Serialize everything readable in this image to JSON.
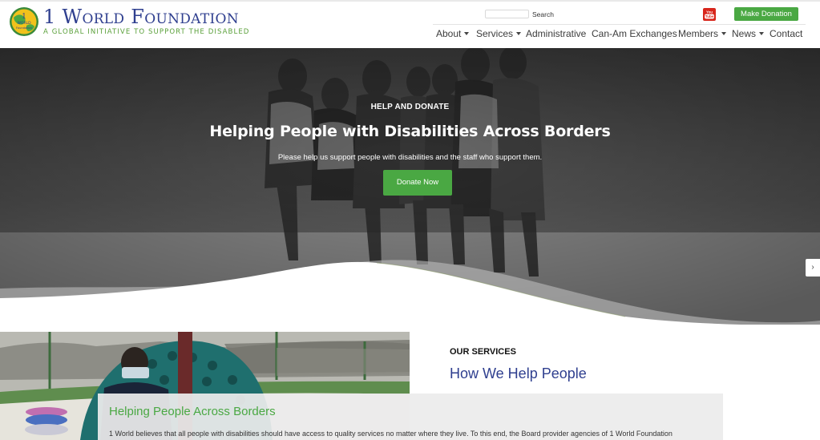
{
  "header": {
    "logo_title": "1 World Foundation",
    "logo_tagline": "A Global Initiative to Support the Disabled",
    "logo_globe_text": "WORLD",
    "logo_globe_sub": "Foundation",
    "search_label": "Search",
    "search_value": "",
    "donate_button": "Make Donation",
    "social_icon": "youtube-icon",
    "accent_green": "#4aa843",
    "brand_blue": "#2f3f8f"
  },
  "nav": {
    "items": [
      {
        "label": "About",
        "dropdown": true
      },
      {
        "label": "Services",
        "dropdown": true
      },
      {
        "label": "Administrative",
        "dropdown": false
      },
      {
        "label": "Can-Am Exchanges",
        "dropdown": false
      },
      {
        "label": "Members",
        "dropdown": true
      },
      {
        "label": "News",
        "dropdown": true
      },
      {
        "label": "Contact",
        "dropdown": false
      }
    ]
  },
  "hero": {
    "eyebrow": "HELP AND DONATE",
    "title": "Helping People with Disabilities Across Borders",
    "subtitle": "Please help us support people with disabilities and the staff who support them.",
    "button": "Donate Now",
    "next_arrow": "›"
  },
  "services": {
    "eyebrow": "OUR SERVICES",
    "heading": "How We Help People",
    "card_title": "Helping People Across Borders",
    "card_text": "1 World believes that all people with disabilities should have access to quality services no matter where they live. To this end, the Board provider agencies of 1 World Foundation"
  }
}
